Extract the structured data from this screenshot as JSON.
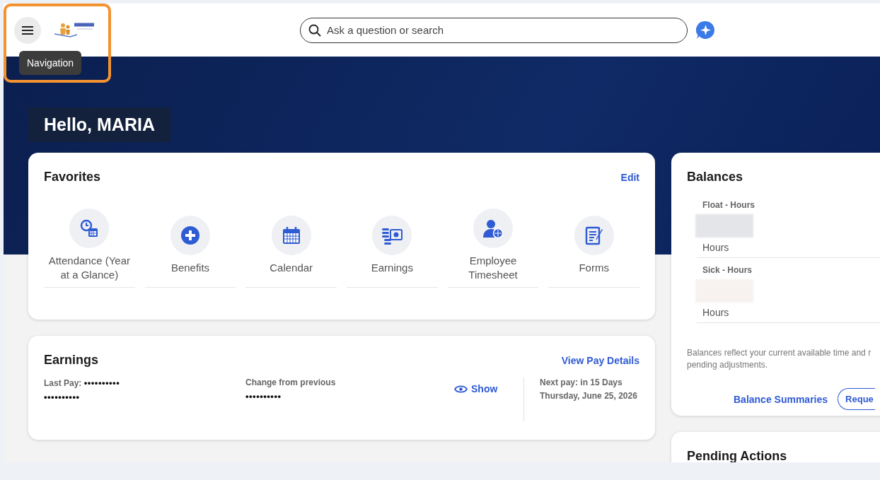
{
  "header": {
    "menu_tooltip": "Navigation",
    "search": {
      "placeholder": "Ask a question or search"
    }
  },
  "greeting": "Hello, MARIA",
  "favorites": {
    "title": "Favorites",
    "edit": "Edit",
    "items": [
      {
        "label": "Attendance (Year at a Glance)",
        "kind": "clock-calendar"
      },
      {
        "label": "Benefits",
        "kind": "plus"
      },
      {
        "label": "Calendar",
        "kind": "calendar"
      },
      {
        "label": "Earnings",
        "kind": "money"
      },
      {
        "label": "Employee Timesheet",
        "kind": "person"
      },
      {
        "label": "Forms",
        "kind": "form"
      }
    ]
  },
  "earnings": {
    "title": "Earnings",
    "link": "View Pay Details",
    "last_pay_label": "Last Pay:",
    "last_pay_value": "••••••••••",
    "last_pay_value_2": "••••••••••",
    "change_label": "Change from previous",
    "change_value": "••••••••••",
    "show": "Show",
    "next_pay": "Next pay: in 15 Days",
    "next_date": "Thursday, June 25, 2026"
  },
  "balances": {
    "title": "Balances",
    "items": [
      {
        "label": "Float - Hours",
        "unit": "Hours",
        "color": "#e3e5e9"
      },
      {
        "label": "Sick - Hours",
        "unit": "Hours",
        "color": "#f7f2ef"
      }
    ],
    "note": "Balances reflect your current available time and r\npending adjustments.",
    "link": "Balance Summaries",
    "button": "Reque"
  },
  "pending": {
    "title": "Pending Actions"
  }
}
